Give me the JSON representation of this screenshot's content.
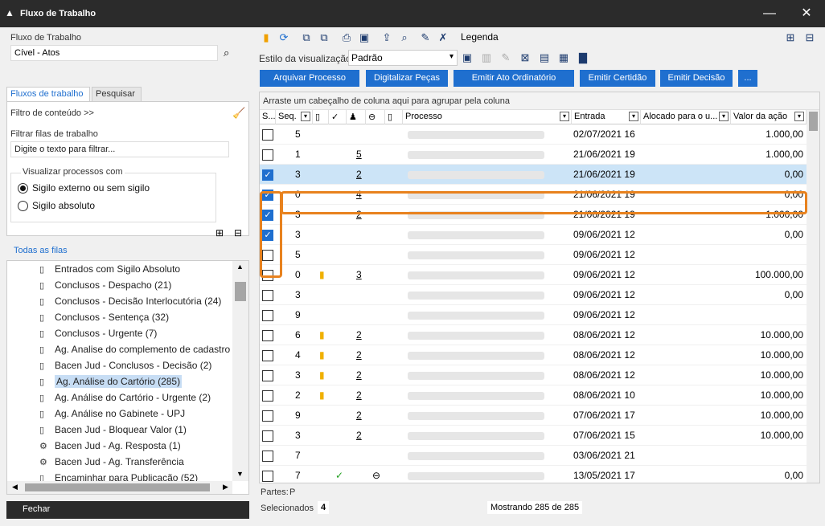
{
  "window": {
    "title": "Fluxo de Trabalho"
  },
  "left": {
    "workflow_label": "Fluxo de Trabalho",
    "workflow_value": "Cível - Atos",
    "tabs": [
      "Fluxos de trabalho",
      "Pesquisar"
    ],
    "content_filter": "Filtro de conteúdo >>",
    "filter_label": "Filtrar filas de trabalho",
    "filter_placeholder": "Digite o texto para filtrar...",
    "visualizar_label": "Visualizar processos com",
    "radio1": "Sigilo externo ou sem sigilo",
    "radio2": "Sigilo absoluto",
    "todas": "Todas as filas",
    "tree": [
      "Entrados com Sigilo Absoluto",
      "Conclusos - Despacho (21)",
      "Conclusos - Decisão Interlocutória (24)",
      "Conclusos - Sentença (32)",
      "Conclusos - Urgente (7)",
      "Ag. Analise do complemento de cadastro",
      "Bacen Jud - Conclusos - Decisão (2)",
      "Ag. Análise do Cartório (285)",
      "Ag. Análise do Cartório - Urgente (2)",
      "Ag. Análise no Gabinete - UPJ",
      "Bacen Jud - Bloquear Valor (1)",
      "Bacen Jud - Ag. Resposta (1)",
      "Bacen Jud - Ag. Transferência",
      "Encaminhar para Publicação (52)"
    ],
    "close": "Fechar"
  },
  "toolbar": {
    "legenda": "Legenda",
    "estilo_label": "Estilo da visualização",
    "estilo_value": "Padrão",
    "actions": [
      "Arquivar Processo",
      "Digitalizar Peças",
      "Emitir Ato Ordinatório",
      "Emitir Certidão",
      "Emitir Decisão",
      "..."
    ]
  },
  "grid": {
    "group_hint": "Arraste um cabeçalho de coluna aqui para agrupar pela coluna",
    "headers": {
      "s": "S...",
      "seq": "Seq.",
      "processo": "Processo",
      "entrada": "Entrada",
      "alocado": "Alocado para o u...",
      "valor": "Valor da ação"
    },
    "rows": [
      {
        "checked": false,
        "seq": "5",
        "flag": false,
        "n": "",
        "check": false,
        "link": false,
        "entrada": "02/07/2021 16",
        "valor": "1.000,00"
      },
      {
        "checked": false,
        "seq": "1",
        "flag": false,
        "n": "5",
        "check": false,
        "link": false,
        "entrada": "21/06/2021 19",
        "valor": "1.000,00"
      },
      {
        "checked": true,
        "seq": "3",
        "flag": false,
        "n": "2",
        "check": false,
        "link": false,
        "entrada": "21/06/2021 19",
        "valor": "0,00"
      },
      {
        "checked": true,
        "seq": "0",
        "flag": false,
        "n": "4",
        "check": false,
        "link": false,
        "entrada": "21/06/2021 19",
        "valor": "0,00"
      },
      {
        "checked": true,
        "seq": "3",
        "flag": false,
        "n": "2",
        "check": false,
        "link": false,
        "entrada": "21/06/2021 19",
        "valor": "1.000,00"
      },
      {
        "checked": true,
        "seq": "3",
        "flag": false,
        "n": "",
        "check": false,
        "link": false,
        "entrada": "09/06/2021 12",
        "valor": "0,00"
      },
      {
        "checked": false,
        "seq": "5",
        "flag": false,
        "n": "",
        "check": false,
        "link": false,
        "entrada": "09/06/2021 12",
        "valor": ""
      },
      {
        "checked": false,
        "seq": "0",
        "flag": true,
        "n": "3",
        "check": false,
        "link": false,
        "entrada": "09/06/2021 12",
        "valor": "100.000,00"
      },
      {
        "checked": false,
        "seq": "3",
        "flag": false,
        "n": "",
        "check": false,
        "link": false,
        "entrada": "09/06/2021 12",
        "valor": "0,00"
      },
      {
        "checked": false,
        "seq": "9",
        "flag": false,
        "n": "",
        "check": false,
        "link": false,
        "entrada": "09/06/2021 12",
        "valor": ""
      },
      {
        "checked": false,
        "seq": "6",
        "flag": true,
        "n": "2",
        "check": false,
        "link": false,
        "entrada": "08/06/2021 12",
        "valor": "10.000,00"
      },
      {
        "checked": false,
        "seq": "4",
        "flag": true,
        "n": "2",
        "check": false,
        "link": false,
        "entrada": "08/06/2021 12",
        "valor": "10.000,00"
      },
      {
        "checked": false,
        "seq": "3",
        "flag": true,
        "n": "2",
        "check": false,
        "link": false,
        "entrada": "08/06/2021 12",
        "valor": "10.000,00"
      },
      {
        "checked": false,
        "seq": "2",
        "flag": true,
        "n": "2",
        "check": false,
        "link": false,
        "entrada": "08/06/2021 10",
        "valor": "10.000,00"
      },
      {
        "checked": false,
        "seq": "9",
        "flag": false,
        "n": "2",
        "check": false,
        "link": false,
        "entrada": "07/06/2021 17",
        "valor": "10.000,00"
      },
      {
        "checked": false,
        "seq": "3",
        "flag": false,
        "n": "2",
        "check": false,
        "link": false,
        "entrada": "07/06/2021 15",
        "valor": "10.000,00"
      },
      {
        "checked": false,
        "seq": "7",
        "flag": false,
        "n": "",
        "check": false,
        "link": false,
        "entrada": "03/06/2021 21",
        "valor": ""
      },
      {
        "checked": false,
        "seq": "7",
        "flag": false,
        "n": "",
        "check": true,
        "link": true,
        "entrada": "13/05/2021 17",
        "valor": "0,00"
      }
    ]
  },
  "footer": {
    "partes": "Partes:",
    "partes_value": "P",
    "selecionados": "Selecionados",
    "selecionados_count": "4",
    "mostrando": "Mostrando 285 de 285"
  }
}
